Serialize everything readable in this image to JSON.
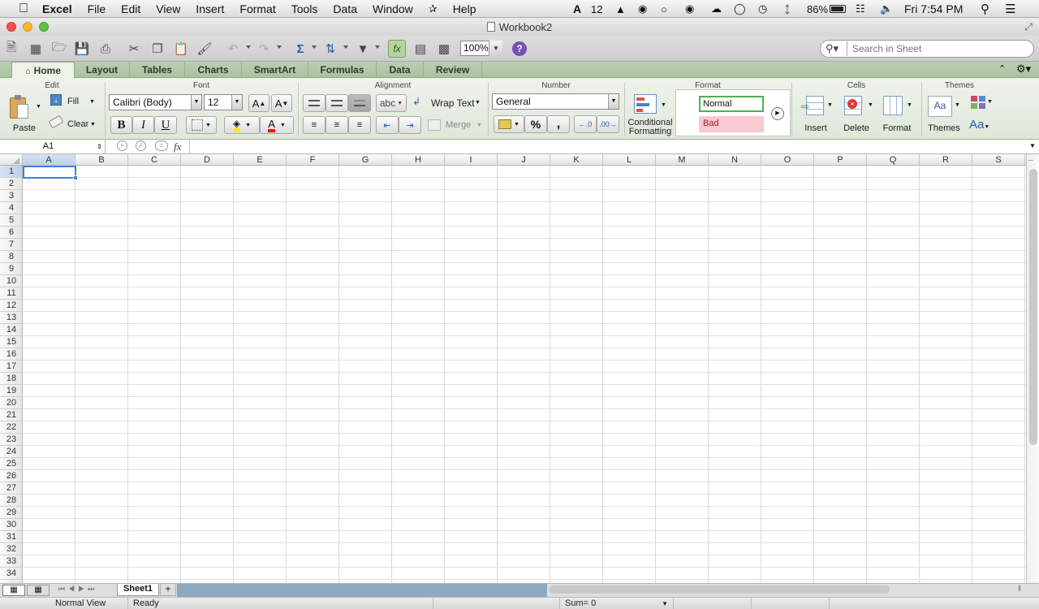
{
  "menubar": {
    "app": "Excel",
    "menus": [
      "File",
      "Edit",
      "View",
      "Insert",
      "Format",
      "Tools",
      "Data",
      "Window",
      "Help"
    ],
    "status_number": "12",
    "battery": "86%",
    "clock": "Fri 7:54 PM"
  },
  "window": {
    "title": "Workbook2"
  },
  "toolbar": {
    "zoom": "100%",
    "search_placeholder": "Search in Sheet"
  },
  "ribbon": {
    "tabs": [
      "Home",
      "Layout",
      "Tables",
      "Charts",
      "SmartArt",
      "Formulas",
      "Data",
      "Review"
    ],
    "active_tab": "Home",
    "groups": [
      "Edit",
      "Font",
      "Alignment",
      "Number",
      "Format",
      "Cells",
      "Themes"
    ],
    "edit": {
      "paste": "Paste",
      "fill": "Fill",
      "clear": "Clear"
    },
    "font": {
      "family": "Calibri (Body)",
      "size": "12",
      "bold": "B",
      "italic": "I",
      "underline": "U",
      "grow": "A",
      "shrink": "A"
    },
    "alignment": {
      "orientation": "abc",
      "wrap_text": "Wrap Text",
      "merge": "Merge"
    },
    "number": {
      "format": "General",
      "percent": "%",
      "comma": ","
    },
    "format": {
      "conditional_line1": "Conditional",
      "conditional_line2": "Formatting",
      "style_normal": "Normal",
      "style_bad": "Bad"
    },
    "cells": {
      "insert": "Insert",
      "delete": "Delete",
      "format": "Format"
    },
    "themes": {
      "themes": "Themes",
      "aa": "Aa",
      "fonts": "Aa"
    }
  },
  "formula_bar": {
    "name_box": "A1",
    "fx": "fx"
  },
  "grid": {
    "columns": [
      "A",
      "B",
      "C",
      "D",
      "E",
      "F",
      "G",
      "H",
      "I",
      "J",
      "K",
      "L",
      "M",
      "N",
      "O",
      "P",
      "Q",
      "R",
      "S"
    ],
    "rows": [
      "1",
      "2",
      "3",
      "4",
      "5",
      "6",
      "7",
      "8",
      "9",
      "10",
      "11",
      "12",
      "13",
      "14",
      "15",
      "16",
      "17",
      "18",
      "19",
      "20",
      "21",
      "22",
      "23",
      "24",
      "25",
      "26",
      "27",
      "28",
      "29",
      "30",
      "31",
      "32",
      "33",
      "34"
    ],
    "selected_cell": "A1"
  },
  "sheets": {
    "tabs": [
      "Sheet1"
    ],
    "add": "+"
  },
  "statusbar": {
    "view": "Normal View",
    "state": "Ready",
    "sum": "Sum= 0"
  }
}
